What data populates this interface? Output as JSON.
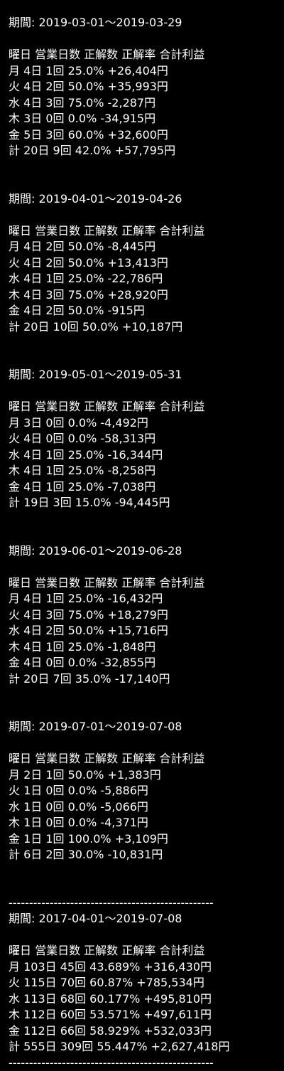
{
  "text_color": "#ffffff",
  "background_color": "#000000",
  "sections": [
    {
      "period": "期間: 2019-03-01〜2019-03-29",
      "header": "曜日 営業日数 正解数 正解率 合計利益",
      "rows": [
        "月 4日 1回 25.0% +26,404円",
        "火 4日 2回 50.0% +35,993円",
        "水 4日 3回 75.0% -2,287円",
        "木 3日 0回 0.0% -34,915円",
        "金 5日 3回 60.0% +32,600円",
        "計 20日 9回 42.0% +57,795円"
      ]
    },
    {
      "period": "期間: 2019-04-01〜2019-04-26",
      "header": "曜日 営業日数 正解数 正解率 合計利益",
      "rows": [
        "月 4日 2回 50.0% -8,445円",
        "火 4日 2回 50.0% +13,413円",
        "水 4日 1回 25.0% -22,786円",
        "木 4日 3回 75.0% +28,920円",
        "金 4日 2回 50.0% -915円",
        "計 20日 10回 50.0% +10,187円"
      ]
    },
    {
      "period": "期間: 2019-05-01〜2019-05-31",
      "header": "曜日 営業日数 正解数 正解率 合計利益",
      "rows": [
        "月 3日 0回 0.0% -4,492円",
        "火 4日 0回 0.0% -58,313円",
        "水 4日 1回 25.0% -16,344円",
        "木 4日 1回 25.0% -8,258円",
        "金 4日 1回 25.0% -7,038円",
        "計 19日 3回 15.0% -94,445円"
      ]
    },
    {
      "period": "期間: 2019-06-01〜2019-06-28",
      "header": "曜日 営業日数 正解数 正解率 合計利益",
      "rows": [
        "月 4日 1回 25.0% -16,432円",
        "火 4日 3回 75.0% +18,279円",
        "水 4日 2回 50.0% +15,716円",
        "木 4日 1回 25.0% -1,848円",
        "金 4日 0回 0.0% -32,855円",
        "計 20日 7回 35.0% -17,140円"
      ]
    },
    {
      "period": "期間: 2019-07-01〜2019-07-08",
      "header": "曜日 営業日数 正解数 正解率 合計利益",
      "rows": [
        "月 2日 1回 50.0% +1,383円",
        "火 1日 0回 0.0% -5,886円",
        "水 1日 0回 0.0% -5,066円",
        "木 1日 0回 0.0% -4,371円",
        "金 1日 1回 100.0% +3,109円",
        "計 6日 2回 30.0% -10,831円"
      ]
    }
  ],
  "divider": "--------------------------------------------------",
  "summary": {
    "period": "期間: 2017-04-01〜2019-07-08",
    "header": "曜日 営業日数 正解数 正解率 合計利益",
    "rows": [
      "月 103日 45回 43.689% +316,430円",
      "火 115日 70回 60.87% +785,534円",
      "水 113日 68回 60.177% +495,810円",
      "木 112日 60回 53.571% +497,611円",
      "金 112日 66回 58.929% +532,033円",
      "計 555日 309回 55.447% +2,627,418円"
    ]
  },
  "divider_bottom": "--------------------------------------------------"
}
